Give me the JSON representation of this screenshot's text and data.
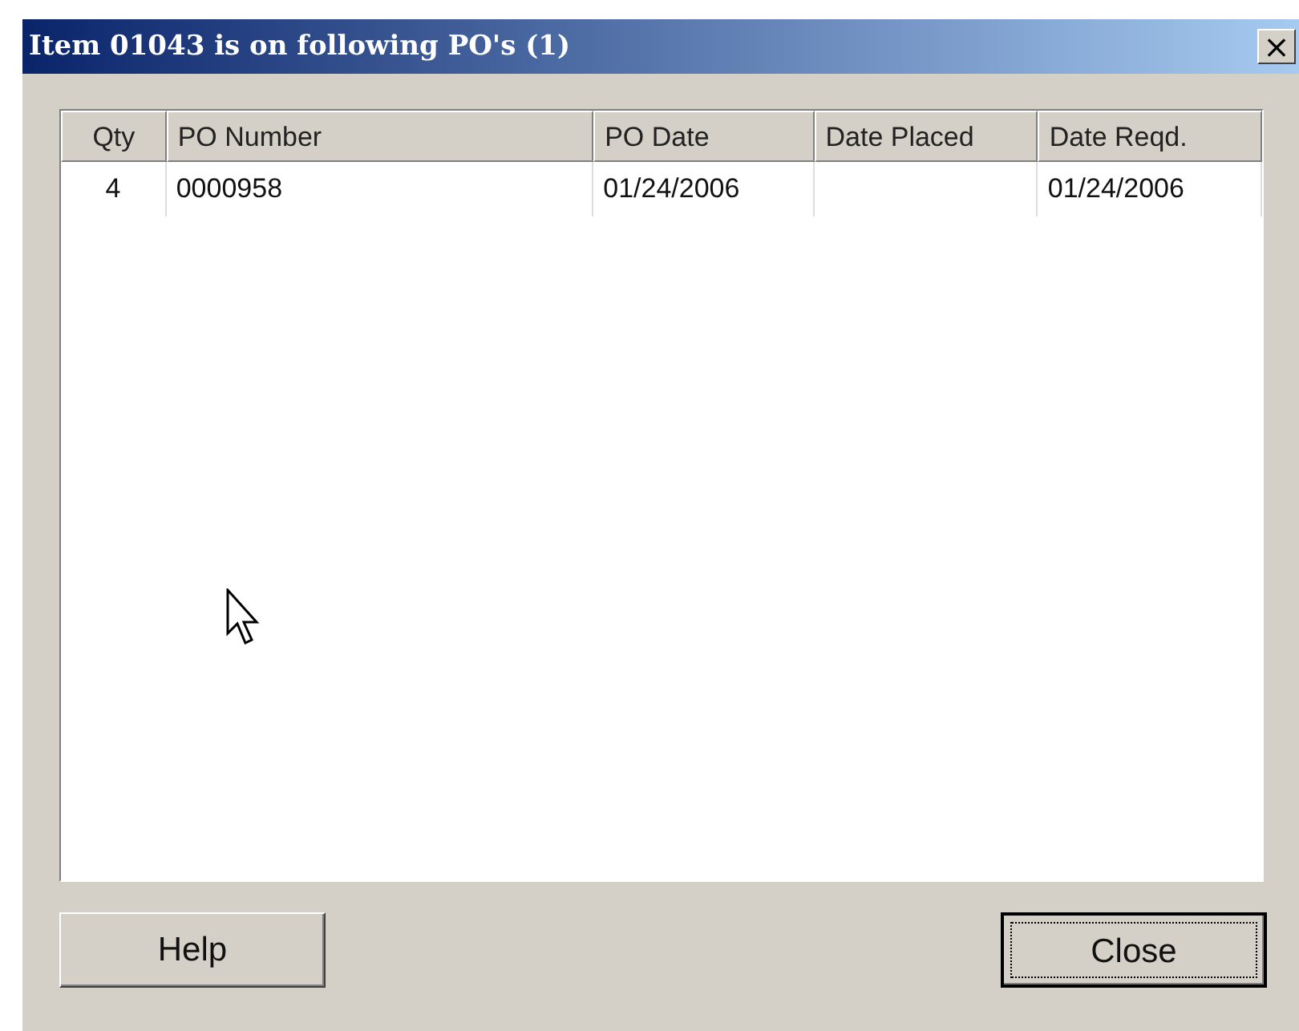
{
  "window": {
    "title": "Item 01043 is on following PO's (1)",
    "close": "×"
  },
  "table": {
    "columns": [
      {
        "label": "Qty"
      },
      {
        "label": "PO Number"
      },
      {
        "label": "PO Date"
      },
      {
        "label": "Date Placed"
      },
      {
        "label": "Date Reqd."
      }
    ],
    "rows": [
      {
        "cells": [
          "4",
          "0000958",
          "01/24/2006",
          "",
          "01/24/2006"
        ]
      }
    ]
  },
  "buttons": [
    {
      "label": "Help",
      "focused": false
    },
    {
      "label": "Close",
      "focused": true
    }
  ]
}
